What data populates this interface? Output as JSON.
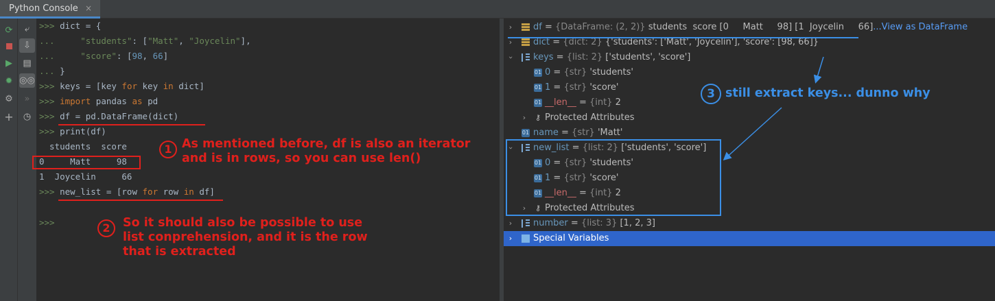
{
  "tab": {
    "title": "Python Console",
    "close": "×"
  },
  "toolbar_left": [
    "rerun-icon",
    "stop-icon",
    "run-icon",
    "debug-icon",
    "settings-icon",
    "add-icon"
  ],
  "toolbar_right": [
    "soft-wrap-icon",
    "scroll-to-end-icon",
    "print-icon",
    "show-variables-icon",
    "execute-icon",
    "history-icon"
  ],
  "console": {
    "lines": [
      {
        "prompt": ">>>",
        "code": " dict = {"
      },
      {
        "prompt": "...",
        "code": "     \"students\": [\"Matt\", \"Joycelin\"],"
      },
      {
        "prompt": "...",
        "code": "     \"score\": [98, 66]"
      },
      {
        "prompt": "...",
        "code": " }"
      },
      {
        "prompt": ">>>",
        "code": " keys = [key for key in dict]"
      },
      {
        "prompt": ">>>",
        "code": " import pandas as pd"
      },
      {
        "prompt": ">>>",
        "code": " df = pd.DataFrame(dict)"
      },
      {
        "prompt": ">>>",
        "code": " print(df)"
      },
      {
        "prompt": "",
        "code": "  students  score"
      },
      {
        "prompt": "",
        "code": "0     Matt     98"
      },
      {
        "prompt": "",
        "code": "1  Joycelin     66"
      },
      {
        "prompt": ">>>",
        "code": " new_list = [row for row in df]"
      },
      {
        "prompt": "",
        "code": ""
      },
      {
        "prompt": ">>>",
        "code": ""
      }
    ]
  },
  "variables": [
    {
      "name": "df",
      "type": "{DataFrame: (2, 2)}",
      "value": "students  score [0     Matt     98] [1  Joycelin     66]",
      "link": "...View as DataFrame",
      "expanded": false
    },
    {
      "name": "dict",
      "type": "{dict: 2}",
      "value": "{'students': ['Matt', 'Joycelin'], 'score': [98, 66]}",
      "expanded": false
    },
    {
      "name": "keys",
      "type": "{list: 2}",
      "value": "['students', 'score']",
      "expanded": true
    },
    {
      "name": "0",
      "type": "{str}",
      "value": "'students'"
    },
    {
      "name": "1",
      "type": "{str}",
      "value": "'score'"
    },
    {
      "name": "__len__",
      "type": "{int}",
      "value": "2"
    },
    {
      "name": "Protected Attributes",
      "type": "",
      "value": ""
    },
    {
      "name": "name",
      "type": "{str}",
      "value": "'Matt'"
    },
    {
      "name": "new_list",
      "type": "{list: 2}",
      "value": "['students', 'score']",
      "expanded": true
    },
    {
      "name": "0",
      "type": "{str}",
      "value": "'students'"
    },
    {
      "name": "1",
      "type": "{str}",
      "value": "'score'"
    },
    {
      "name": "__len__",
      "type": "{int}",
      "value": "2"
    },
    {
      "name": "Protected Attributes",
      "type": "",
      "value": ""
    },
    {
      "name": "number",
      "type": "{list: 3}",
      "value": "[1, 2, 3]",
      "expanded": false
    },
    {
      "name": "Special Variables",
      "type": "",
      "value": ""
    }
  ],
  "annotations": {
    "a1_num": "1",
    "a1_line1": "As mentioned before, df is also an iterator",
    "a1_line2": "and is in rows, so you can use len()",
    "a2_num": "2",
    "a2_line1": "So it should also be possible to use",
    "a2_line2": "list conprehension, and it is the row",
    "a2_line3": "that is extracted",
    "a3_num": "3",
    "a3_text": "still extract keys... dunno why"
  },
  "colors": {
    "red": "#e0201c",
    "blue": "#3b8fe6",
    "selection": "#2f65ca"
  }
}
